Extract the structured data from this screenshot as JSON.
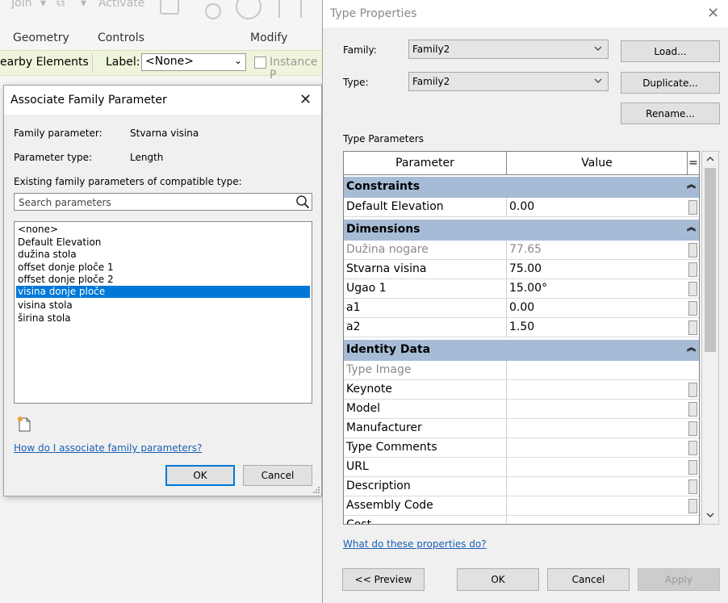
{
  "ribbon": {
    "top_faded": [
      "Join",
      "Activate"
    ],
    "groups": [
      "Geometry",
      "Controls",
      "Modify"
    ],
    "context_text": "earby Elements",
    "label_caption": "Label:",
    "label_value": "<None>",
    "instance_text": "Instance P"
  },
  "associate_dialog": {
    "title": "Associate Family Parameter",
    "family_parameter_label": "Family parameter:",
    "family_parameter_value": "Stvarna visina",
    "parameter_type_label": "Parameter type:",
    "parameter_type_value": "Length",
    "existing_label": "Existing family parameters of compatible type:",
    "search_placeholder": "Search parameters",
    "parameters": [
      "<none>",
      "Default Elevation",
      "dužina stola",
      "offset donje ploče 1",
      "offset donje ploče 2",
      "visina donje ploče",
      "visina stola",
      "širina stola"
    ],
    "selected_index": 5,
    "help_link": "How do I associate family parameters?",
    "ok_label": "OK",
    "cancel_label": "Cancel"
  },
  "type_properties": {
    "title": "Type Properties",
    "family_label": "Family:",
    "family_value": "Family2",
    "type_label": "Type:",
    "type_value": "Family2",
    "load_label": "Load...",
    "duplicate_label": "Duplicate...",
    "rename_label": "Rename...",
    "section_label": "Type Parameters",
    "col_parameter": "Parameter",
    "col_value": "Value",
    "col_eq": "=",
    "groups": {
      "constraints": "Constraints",
      "dimensions": "Dimensions",
      "identity": "Identity Data"
    },
    "rows": {
      "default_elevation": {
        "p": "Default Elevation",
        "v": "0.00"
      },
      "duzina_nogare": {
        "p": "Dužina nogare",
        "v": "77.65"
      },
      "stvarna_visina": {
        "p": "Stvarna visina",
        "v": "75.00"
      },
      "ugao_1": {
        "p": "Ugao 1",
        "v": "15.00°"
      },
      "a1": {
        "p": "a1",
        "v": "0.00"
      },
      "a2": {
        "p": "a2",
        "v": "1.50"
      },
      "type_image": {
        "p": "Type Image",
        "v": ""
      },
      "keynote": {
        "p": "Keynote",
        "v": ""
      },
      "model": {
        "p": "Model",
        "v": ""
      },
      "manufacturer": {
        "p": "Manufacturer",
        "v": ""
      },
      "type_comments": {
        "p": "Type Comments",
        "v": ""
      },
      "url": {
        "p": "URL",
        "v": ""
      },
      "description": {
        "p": "Description",
        "v": ""
      },
      "assembly_code": {
        "p": "Assembly Code",
        "v": ""
      },
      "cost": {
        "p": "Cost",
        "v": ""
      }
    },
    "help_link": "What do these properties do?",
    "preview_label": "<< Preview",
    "ok_label": "OK",
    "cancel_label": "Cancel",
    "apply_label": "Apply"
  },
  "colors": {
    "accent": "#0078d7",
    "group_header": "#a6bcd6",
    "context_tab": "#eef5dc",
    "link": "#1a5fb4"
  }
}
